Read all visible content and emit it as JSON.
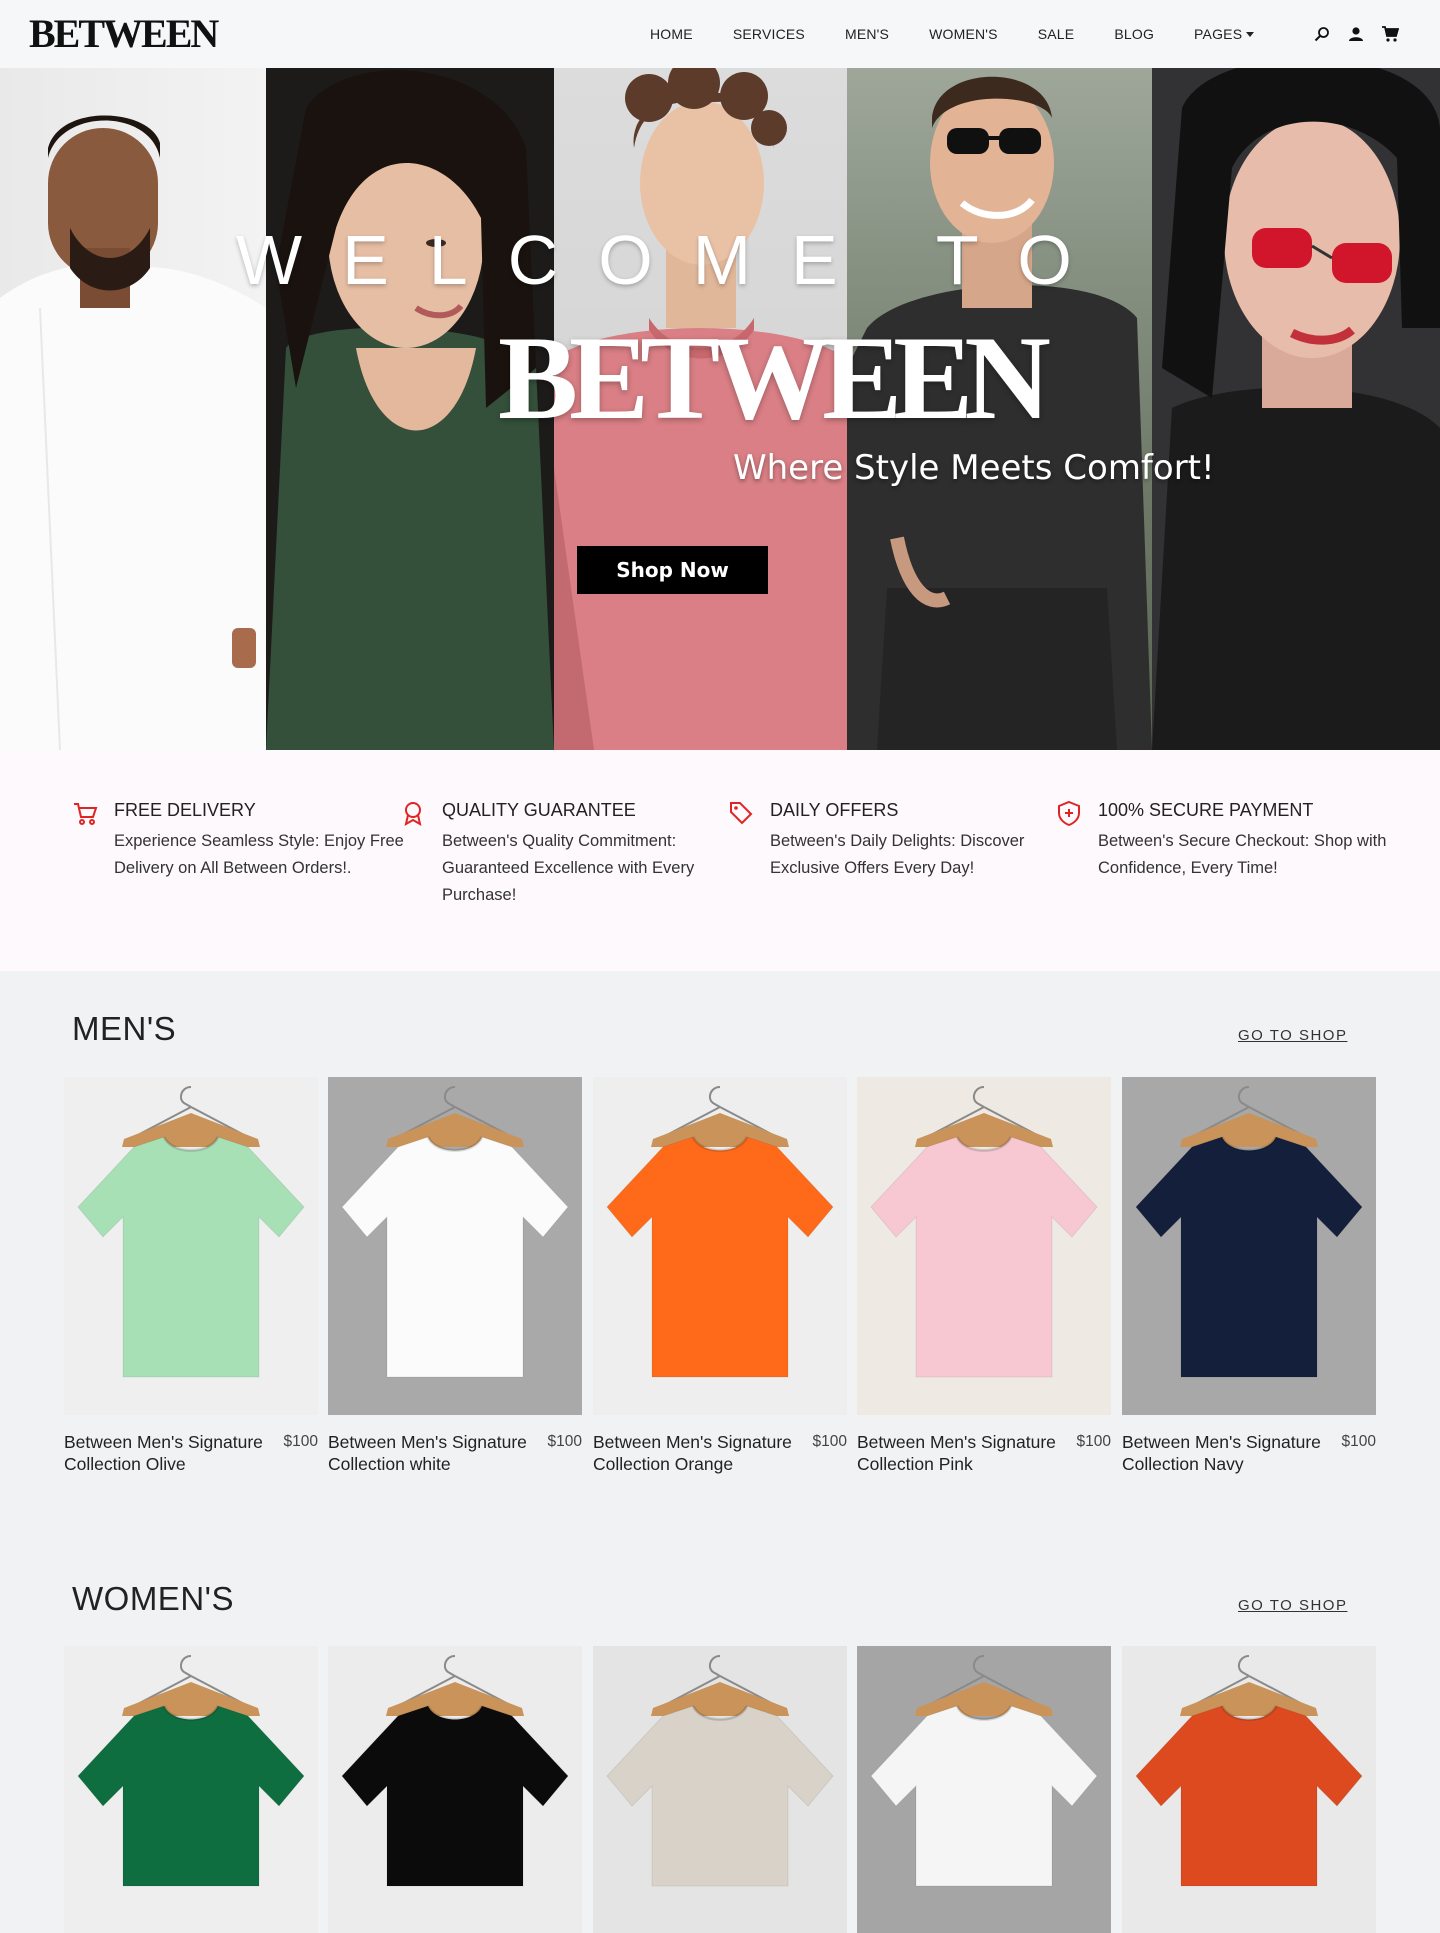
{
  "brand": {
    "logo": "BETWEEN"
  },
  "nav": {
    "items": [
      "HOME",
      "SERVICES",
      "MEN'S",
      "WOMEN'S",
      "SALE",
      "BLOG",
      "PAGES"
    ],
    "icons": [
      "search-icon",
      "user-icon",
      "cart-icon"
    ]
  },
  "hero": {
    "welcome": "WELCOME TO",
    "title": "BETWEEN",
    "subtitle": "Where Style Meets Comfort!",
    "cta": "Shop Now"
  },
  "features": [
    {
      "icon": "cart-icon",
      "title": "FREE DELIVERY",
      "text": "Experience Seamless Style: Enjoy Free Delivery on All Between Orders!."
    },
    {
      "icon": "award-icon",
      "title": "QUALITY GUARANTEE",
      "text": "Between's Quality Commitment: Guaranteed Excellence with Every Purchase!"
    },
    {
      "icon": "tag-icon",
      "title": "DAILY OFFERS",
      "text": "Between's Daily Delights: Discover Exclusive Offers Every Day!"
    },
    {
      "icon": "shield-icon",
      "title": "100% SECURE PAYMENT",
      "text": "Between's Secure Checkout: Shop with Confidence, Every Time!"
    }
  ],
  "mens": {
    "title": "MEN'S",
    "link": "GO TO SHOP",
    "products": [
      {
        "name": "Between Men's Signature Collection Olive",
        "price": "$100",
        "shirt_color": "#a8e0b6",
        "bg_color": "#efefef"
      },
      {
        "name": "Between Men's Signature Collection white",
        "price": "$100",
        "shirt_color": "#fbfbfb",
        "bg_color": "#a9a9a9"
      },
      {
        "name": "Between Men's Signature Collection Orange",
        "price": "$100",
        "shirt_color": "#ff6a1a",
        "bg_color": "#eeeeee"
      },
      {
        "name": "Between Men's Signature Collection Pink",
        "price": "$100",
        "shirt_color": "#f7c8d2",
        "bg_color": "#efe9e4"
      },
      {
        "name": "Between Men's Signature Collection Navy",
        "price": "$100",
        "shirt_color": "#141f3c",
        "bg_color": "#a8a8a8"
      }
    ]
  },
  "womens": {
    "title": "WOMEN'S",
    "link": "GO TO SHOP",
    "products": [
      {
        "shirt_color": "#0e6e3f",
        "bg_color": "#eeeeee"
      },
      {
        "shirt_color": "#0b0b0b",
        "bg_color": "#ececec"
      },
      {
        "shirt_color": "#d8d2c8",
        "bg_color": "#e4e4e4"
      },
      {
        "shirt_color": "#f5f5f5",
        "bg_color": "#a5a5a5"
      },
      {
        "shirt_color": "#dd4a1f",
        "bg_color": "#e9e9e9"
      }
    ]
  },
  "colors": {
    "accent": "#e02424",
    "dark": "#000000"
  }
}
